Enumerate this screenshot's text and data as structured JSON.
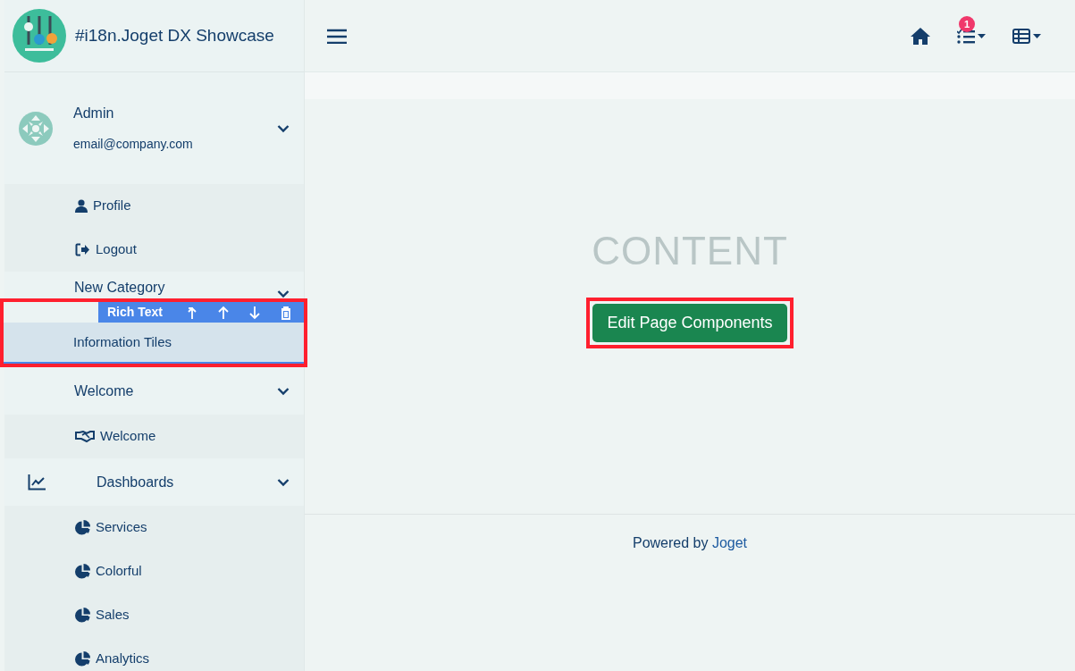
{
  "brand": {
    "title": "#i18n.Joget DX Showcase"
  },
  "header": {
    "notification_count": "1"
  },
  "user": {
    "name": "Admin",
    "email": "email@company.com",
    "expanded": true,
    "menu": [
      {
        "label": "Profile"
      },
      {
        "label": "Logout"
      }
    ]
  },
  "menu": [
    {
      "label": "New Category",
      "expanded": true,
      "children": [
        {
          "label": "Information Tiles",
          "selected": true
        }
      ]
    },
    {
      "label": "Welcome",
      "expanded": true,
      "children": [
        {
          "label": "Welcome",
          "selected": false
        }
      ]
    },
    {
      "label": "Dashboards",
      "expanded": true,
      "children": [
        {
          "label": "Services",
          "selected": false
        },
        {
          "label": "Colorful",
          "selected": false
        },
        {
          "label": "Sales",
          "selected": false
        },
        {
          "label": "Analytics",
          "selected": false
        }
      ]
    }
  ],
  "editor_toolbar": {
    "label": "Rich Text"
  },
  "content": {
    "placeholder_title": "CONTENT",
    "button": "Edit Page Components",
    "button_selected": true
  },
  "footer": {
    "text": "Powered by",
    "link": "Joget"
  }
}
